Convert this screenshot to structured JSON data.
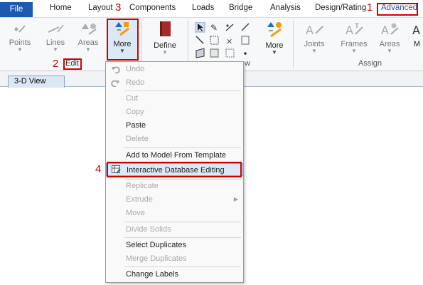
{
  "tabs": {
    "file": "File",
    "home": "Home",
    "layout": "Layout",
    "components": "Components",
    "loads": "Loads",
    "bridge": "Bridge",
    "analysis": "Analysis",
    "design_rating": "Design/Rating",
    "advanced": "Advanced"
  },
  "ribbon": {
    "points": "Points",
    "lines": "Lines",
    "areas": "Areas",
    "more": "More",
    "define": "Define",
    "view_more": "More",
    "joints": "Joints",
    "frames": "Frames",
    "areas2": "Areas",
    "more_cut": "M",
    "group_edit": "Edit",
    "group_view": "w",
    "group_assign": "Assign"
  },
  "view_tab": "3-D View",
  "annotations": {
    "n1": "1",
    "n2": "2",
    "n3": "3",
    "n4": "4"
  },
  "menu": {
    "undo": "Undo",
    "redo": "Redo",
    "cut": "Cut",
    "copy": "Copy",
    "paste": "Paste",
    "delete": "Delete",
    "add_from_template": "Add to Model From Template",
    "interactive_db": "Interactive Database Editing",
    "replicate": "Replicate",
    "extrude": "Extrude",
    "move": "Move",
    "divide_solids": "Divide Solids",
    "select_duplicates": "Select Duplicates",
    "merge_duplicates": "Merge Duplicates",
    "change_labels": "Change Labels"
  },
  "colors": {
    "file_tab": "#1e5bb0",
    "highlight": "#d00000",
    "advanced_text": "#1e5bb0"
  }
}
